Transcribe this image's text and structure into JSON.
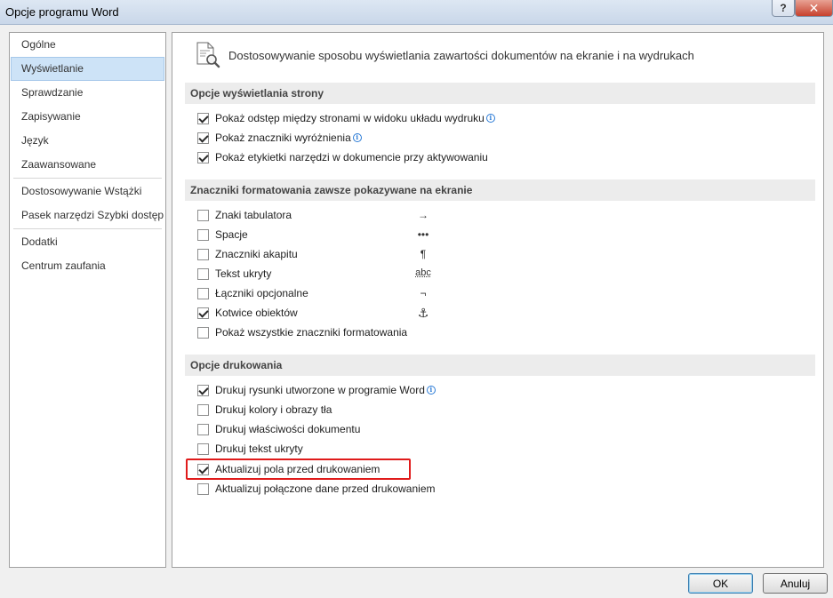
{
  "window": {
    "title": "Opcje programu Word",
    "help_label": "?",
    "close_label": "✕"
  },
  "nav": {
    "groups": [
      [
        "Ogólne",
        "Wyświetlanie",
        "Sprawdzanie",
        "Zapisywanie",
        "Język",
        "Zaawansowane"
      ],
      [
        "Dostosowywanie Wstążki",
        "Pasek narzędzi Szybki dostęp"
      ],
      [
        "Dodatki",
        "Centrum zaufania"
      ]
    ],
    "selected": "Wyświetlanie"
  },
  "header": {
    "text": "Dostosowywanie sposobu wyświetlania zawartości dokumentów na ekranie i na wydrukach"
  },
  "sections": [
    {
      "title": "Opcje wyświetlania strony",
      "options": [
        {
          "label": "Pokaż odstęp między stronami w widoku układu wydruku",
          "checked": true,
          "info": true
        },
        {
          "label": "Pokaż znaczniki wyróżnienia",
          "checked": true,
          "info": true
        },
        {
          "label": "Pokaż etykietki narzędzi w dokumencie przy aktywowaniu",
          "checked": true,
          "info": false
        }
      ]
    },
    {
      "title": "Znaczniki formatowania zawsze pokazywane na ekranie",
      "options": [
        {
          "label": "Znaki tabulatora",
          "checked": false,
          "mark": "→"
        },
        {
          "label": "Spacje",
          "checked": false,
          "mark": "•••"
        },
        {
          "label": "Znaczniki akapitu",
          "checked": false,
          "mark": "¶"
        },
        {
          "label": "Tekst ukryty",
          "checked": false,
          "mark": "abc"
        },
        {
          "label": "Łączniki opcjonalne",
          "checked": false,
          "mark": "¬"
        },
        {
          "label": "Kotwice obiektów",
          "checked": true,
          "mark": "⚓"
        },
        {
          "label": "Pokaż wszystkie znaczniki formatowania",
          "checked": false,
          "mark": ""
        }
      ]
    },
    {
      "title": "Opcje drukowania",
      "options": [
        {
          "label": "Drukuj rysunki utworzone w programie Word",
          "checked": true,
          "info": true
        },
        {
          "label": "Drukuj kolory i obrazy tła",
          "checked": false
        },
        {
          "label": "Drukuj właściwości dokumentu",
          "checked": false
        },
        {
          "label": "Drukuj tekst ukryty",
          "checked": false
        },
        {
          "label": "Aktualizuj pola przed drukowaniem",
          "checked": true,
          "highlighted": true
        },
        {
          "label": "Aktualizuj połączone dane przed drukowaniem",
          "checked": false
        }
      ]
    }
  ],
  "buttons": {
    "ok": "OK",
    "cancel": "Anuluj"
  },
  "colors": {
    "highlight_border": "#e01b1b",
    "selected_nav": "#cde3f7",
    "info": "#2b7bd6"
  }
}
